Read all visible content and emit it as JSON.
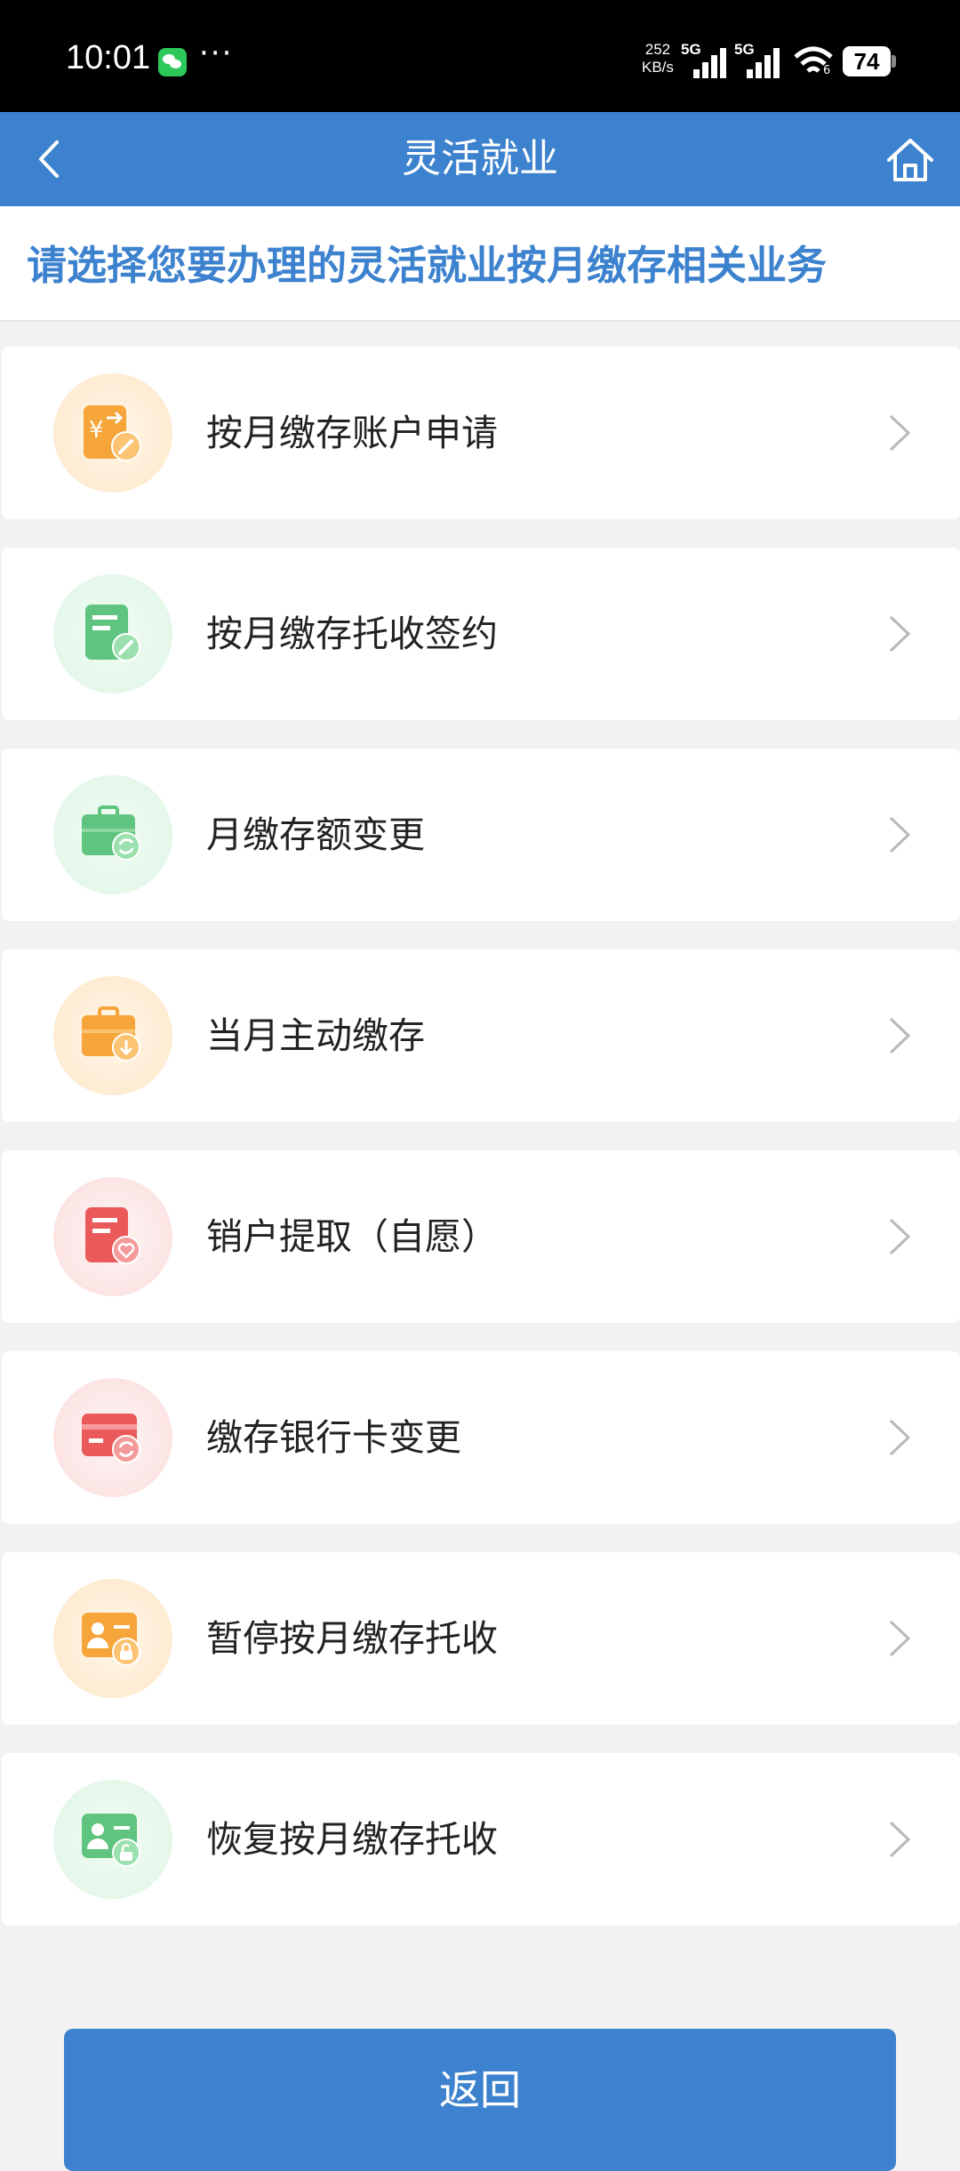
{
  "status_bar": {
    "time": "10:01",
    "more": "···",
    "net_speed_value": "252",
    "net_speed_unit": "KB/s",
    "signal1_label": "5G",
    "signal2_label": "5G",
    "wifi_label": "6",
    "battery": "74"
  },
  "header": {
    "title": "灵活就业"
  },
  "instruction": "请选择您要办理的灵活就业按月缴存相关业务",
  "services": [
    {
      "label": "按月缴存账户申请",
      "icon": "account-apply-icon",
      "tone": "orange"
    },
    {
      "label": "按月缴存托收签约",
      "icon": "contract-sign-icon",
      "tone": "green"
    },
    {
      "label": "月缴存额变更",
      "icon": "amount-change-icon",
      "tone": "green"
    },
    {
      "label": "当月主动缴存",
      "icon": "active-deposit-icon",
      "tone": "orange"
    },
    {
      "label": "销户提取（自愿）",
      "icon": "close-account-icon",
      "tone": "red"
    },
    {
      "label": "缴存银行卡变更",
      "icon": "bank-card-change-icon",
      "tone": "red"
    },
    {
      "label": "暂停按月缴存托收",
      "icon": "suspend-icon",
      "tone": "orange"
    },
    {
      "label": "恢复按月缴存托收",
      "icon": "resume-icon",
      "tone": "green"
    }
  ],
  "return_button": "返回",
  "colors": {
    "primary": "#3d82ce",
    "orange": "#f5a53a",
    "green": "#5fc47f",
    "red": "#ea5a5a"
  }
}
